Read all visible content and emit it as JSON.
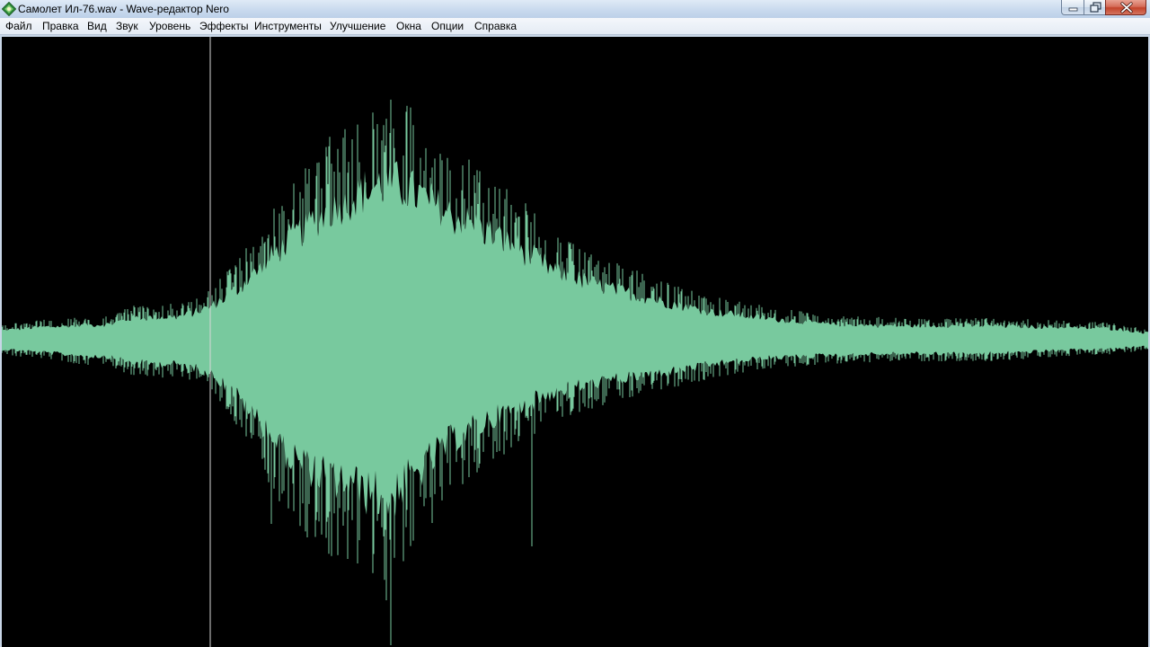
{
  "window": {
    "title": "Самолет Ил-76.wav - Wave-редактор Nero"
  },
  "menu": {
    "items": [
      "Файл",
      "Правка",
      "Вид",
      "Звук",
      "Уровень",
      "Эффекты",
      "Инструменты",
      "Улучшение",
      "Окна",
      "Опции",
      "Справка"
    ]
  },
  "colors": {
    "waveform": "#78c99e",
    "background": "#000000",
    "cursor_line": "#d8d8d8"
  },
  "icons": {
    "app": "nero-wave-editor-icon",
    "minimize": "minimize-icon",
    "maximize": "maximize-icon",
    "close": "close-icon"
  }
}
